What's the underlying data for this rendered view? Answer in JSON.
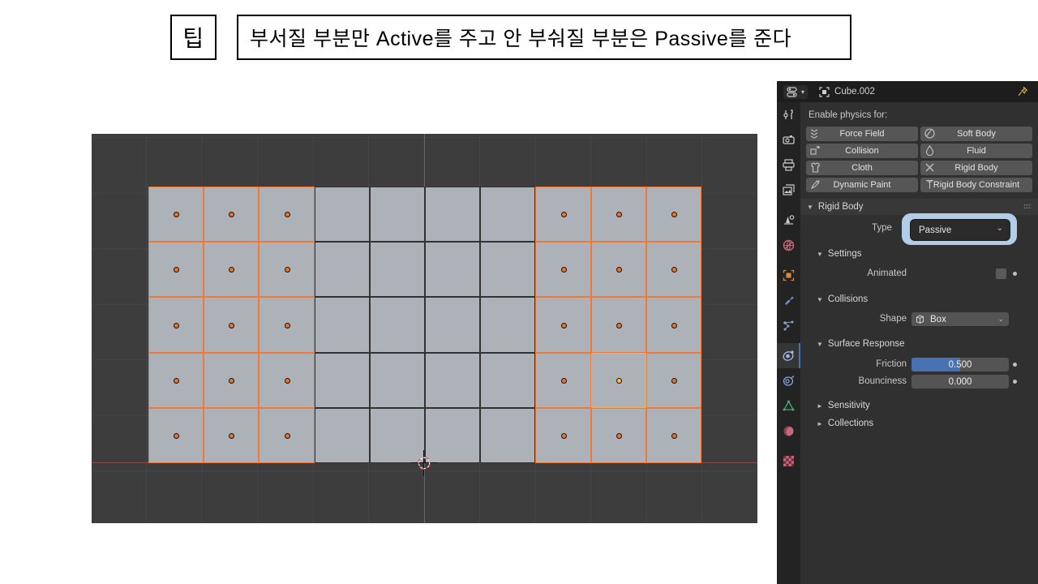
{
  "caption": {
    "tip_label": "팁",
    "text": "부서질 부분만 Active를 주고 안 부숴질 부분은 Passive를 준다"
  },
  "viewport": {
    "name": "3d-viewport",
    "background_color": "#3d3d3d",
    "cube_face_color": "#adb2b8",
    "selected_outline_color": "#f07838",
    "active_outline_color": "#ffa846",
    "unselected_outline_color": "#323232",
    "x_axis_color": "#8a4a4a",
    "z_axis_color": "#4a6b8a",
    "grid": {
      "columns": 10,
      "rows": 5
    },
    "selected_columns": [
      1,
      2,
      3,
      8,
      9,
      10
    ],
    "unselected_columns": [
      4,
      5,
      6,
      7
    ],
    "active_cube": {
      "column": 9,
      "row": 4
    },
    "cursor_3d_label": "3d-cursor"
  },
  "properties": {
    "header": {
      "editor_type": "properties-editor",
      "object_name": "Cube.002",
      "pin_label": "pin-id"
    },
    "tabs": [
      {
        "name": "tool",
        "icon": "tool-icon",
        "active": false
      },
      {
        "name": "render",
        "icon": "camera-back-icon",
        "active": false
      },
      {
        "name": "output",
        "icon": "printer-icon",
        "active": false
      },
      {
        "name": "view-layer",
        "icon": "images-icon",
        "active": false
      },
      {
        "name": "scene",
        "icon": "cone-sphere-icon",
        "active": false
      },
      {
        "name": "world",
        "icon": "world-icon",
        "active": false
      },
      {
        "name": "object",
        "icon": "object-square-icon",
        "active": false
      },
      {
        "name": "modifiers",
        "icon": "wrench-icon",
        "active": false
      },
      {
        "name": "particles",
        "icon": "particles-icon",
        "active": false
      },
      {
        "name": "physics",
        "icon": "physics-orbit-icon",
        "active": true
      },
      {
        "name": "object-constraints",
        "icon": "constraint-icon",
        "active": false
      },
      {
        "name": "object-data",
        "icon": "mesh-data-triangle-icon",
        "active": false
      },
      {
        "name": "material",
        "icon": "material-sphere-icon",
        "active": false
      },
      {
        "name": "texture",
        "icon": "checker-texture-icon",
        "active": false
      }
    ],
    "enable_physics_label": "Enable physics for:",
    "physics_buttons": [
      {
        "label": "Force Field",
        "icon": "force-field-icon"
      },
      {
        "label": "Soft Body",
        "icon": "soft-body-icon"
      },
      {
        "label": "Collision",
        "icon": "collision-icon"
      },
      {
        "label": "Fluid",
        "icon": "fluid-drop-icon"
      },
      {
        "label": "Cloth",
        "icon": "cloth-shirt-icon"
      },
      {
        "label": "Rigid Body",
        "icon": "remove-x-icon"
      },
      {
        "label": "Dynamic Paint",
        "icon": "dynamic-paint-icon"
      },
      {
        "label": "Rigid Body Constraint",
        "icon": "rigid-body-constraint-icon"
      }
    ],
    "rigid_body": {
      "section_label": "Rigid Body",
      "type_label": "Type",
      "type_value": "Passive",
      "highlight_color": "#b2cdea",
      "settings_label": "Settings",
      "animated_label": "Animated",
      "animated_checked": false,
      "collisions_label": "Collisions",
      "shape_label": "Shape",
      "shape_value": "Box",
      "shape_icon": "box-shape-icon",
      "surface_response_label": "Surface Response",
      "friction_label": "Friction",
      "friction_value": "0.500",
      "friction_fill_percent": 50,
      "bounciness_label": "Bounciness",
      "bounciness_value": "0.000",
      "bounciness_fill_percent": 0,
      "sensitivity_label": "Sensitivity",
      "collections_label": "Collections",
      "slider_fill_color": "#4772b3"
    }
  }
}
